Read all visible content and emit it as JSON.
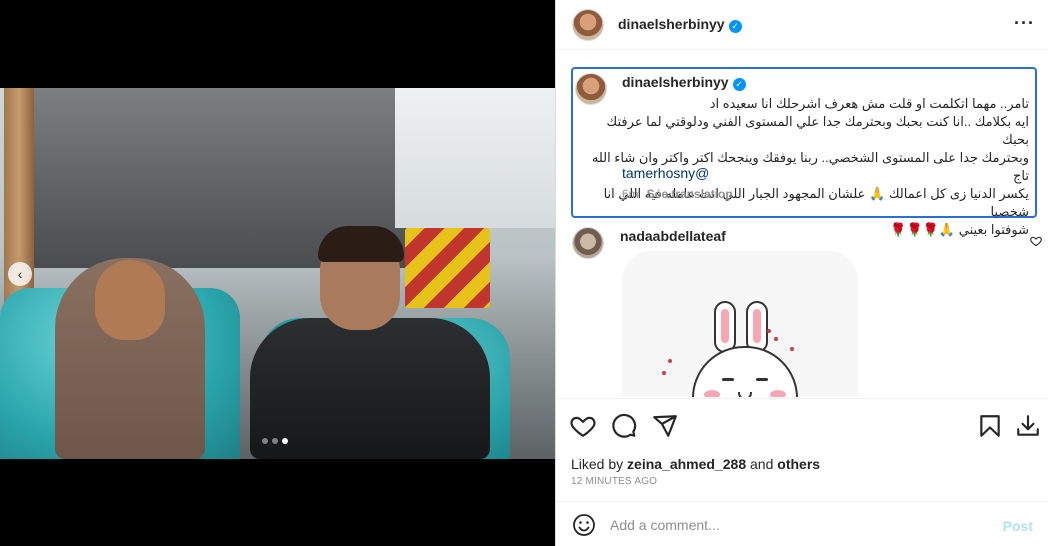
{
  "post": {
    "carousel": {
      "slide_count": 3,
      "active_slide": 3,
      "prev_glyph": "‹"
    },
    "photo": {
      "label": "post-photo"
    }
  },
  "header": {
    "username": "dinaelsherbinyy",
    "verified_glyph": "✓",
    "more_glyph": "···"
  },
  "caption": {
    "username": "dinaelsherbinyy",
    "lines": [
      "تامر.. مهما اتكلمت او قلت مش هعرف اشرحلك انا سعيده اد",
      "ايه بكلامك ..انا كنت بحبك وبحترمك جدا علي المستوى الفني ودلوقتي لما عرفتك بحبك",
      "وبحترمك جدا على المستوى الشخصي.. ربنا يوفقك وينجحك اكتر واكتر وان شاء الله تاج",
      "يكسر الدنيا زى كل اعمالك 🙏 علشان المجهود الجبار اللي انت عامله فيه اللي انا شخصيا",
      "شوفتوا بعيني 🙏🌹🌹🌹"
    ],
    "mention": "tamerhosny@",
    "time_ago": "6m",
    "see_translation": "See translation"
  },
  "comment": {
    "username": "nadaabdellateaf"
  },
  "actions": {
    "like_icon": "heart-icon",
    "comment_icon": "comment-icon",
    "share_icon": "share-icon",
    "save_icon": "bookmark-icon",
    "download_icon": "download-icon"
  },
  "likes": {
    "prefix": "Liked by ",
    "user": "zeina_ahmed_288",
    "and": " and ",
    "others": "others"
  },
  "timestamp": "12 MINUTES AGO",
  "add_comment": {
    "placeholder": "Add a comment...",
    "post_label": "Post"
  },
  "colors": {
    "accent": "#0095f6",
    "focus_border": "#2a6fd6",
    "post_disabled": "#b2dffc",
    "muted": "#8e8e8e",
    "text": "#262626"
  }
}
